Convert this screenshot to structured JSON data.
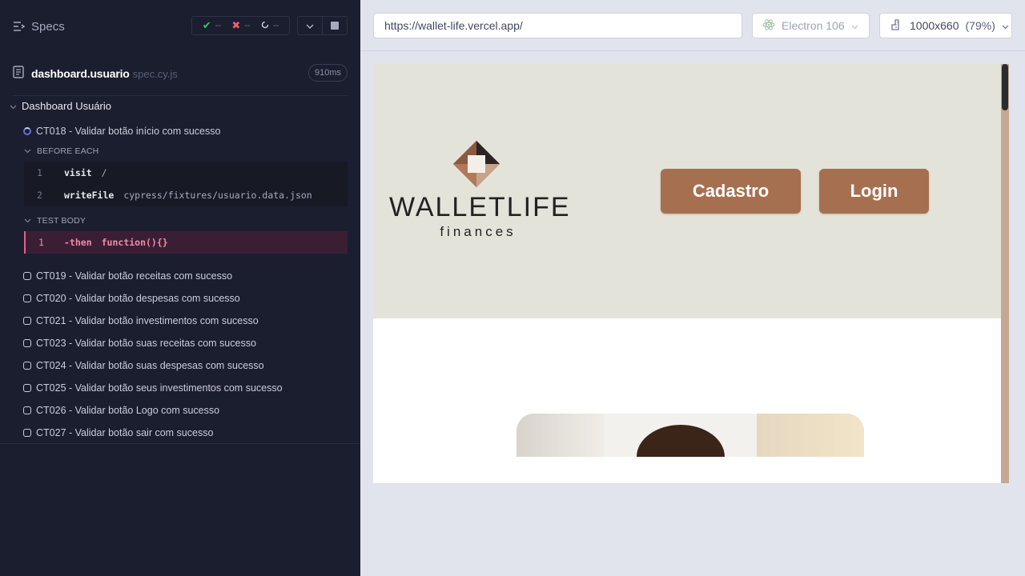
{
  "sidebar": {
    "specs_label": "Specs",
    "stats": {
      "passed": "--",
      "failed": "--",
      "pending": "--"
    },
    "spec": {
      "name": "dashboard.usuario",
      "ext": "spec.cy.js",
      "duration": "910ms"
    },
    "suite_title": "Dashboard Usuário",
    "active_test": "CT018 - Validar botão início com sucesso",
    "before_each_label": "BEFORE EACH",
    "before_each": [
      {
        "num": "1",
        "name": "visit",
        "arg": "/"
      },
      {
        "num": "2",
        "name": "writeFile",
        "arg": "cypress/fixtures/usuario.data.json"
      }
    ],
    "test_body_label": "TEST BODY",
    "test_body": [
      {
        "num": "1",
        "name": "-then",
        "arg": "function(){}"
      }
    ],
    "tests": [
      "CT019 - Validar botão receitas com sucesso",
      "CT020 - Validar botão despesas com sucesso",
      "CT021 - Validar botão investimentos com sucesso",
      "CT023 - Validar botão suas receitas com sucesso",
      "CT024 - Validar botão suas despesas com sucesso",
      "CT025 - Validar botão seus investimentos com sucesso",
      "CT026 - Validar botão Logo com sucesso",
      "CT027 - Validar botão sair com sucesso"
    ]
  },
  "toolbar": {
    "url": "https://wallet-life.vercel.app/",
    "browser": "Electron 106",
    "viewport_size": "1000x660",
    "viewport_scale": "(79%)"
  },
  "app": {
    "logo_word": "WALLETLIFE",
    "logo_sub": "finances",
    "cadastro_label": "Cadastro",
    "login_label": "Login"
  },
  "colors": {
    "sidebar_bg": "#1b1e2e",
    "fail_accent": "#e5608a",
    "app_hero_bg": "#e4e3da",
    "app_button": "#a67050"
  }
}
